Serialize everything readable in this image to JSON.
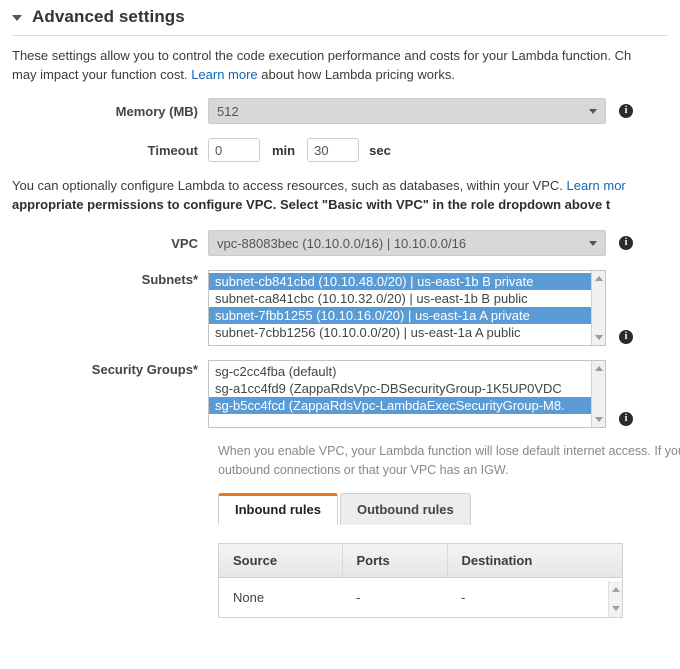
{
  "section": {
    "title": "Advanced settings",
    "collapse_icon": "caret-down-icon"
  },
  "intro": {
    "line1": "These settings allow you to control the code execution performance and costs for your Lambda function. Ch",
    "line2_before_link": "may impact your function cost. ",
    "link_text": "Learn more",
    "line2_after_link": " about how Lambda pricing works."
  },
  "memory": {
    "label": "Memory (MB)",
    "value": "512",
    "info_icon": "info-icon"
  },
  "timeout": {
    "label": "Timeout",
    "minutes": "0",
    "minutes_unit": "min",
    "seconds": "30",
    "seconds_unit": "sec"
  },
  "vpc_intro": {
    "line1_before_link": "You can optionally configure Lambda to access resources, such as databases, within your VPC. ",
    "link_text": "Learn mor",
    "line2": "appropriate permissions to configure VPC. Select \"Basic with VPC\" in the role dropdown above t"
  },
  "vpc": {
    "label": "VPC",
    "value": "vpc-88083bec (10.10.0.0/16) | 10.10.0.0/16",
    "info_icon": "info-icon"
  },
  "subnets": {
    "label": "Subnets*",
    "options": [
      {
        "text": "subnet-cb841cbd (10.10.48.0/20) | us-east-1b B private",
        "selected": true
      },
      {
        "text": "subnet-ca841cbc (10.10.32.0/20) | us-east-1b B public",
        "selected": false
      },
      {
        "text": "subnet-7fbb1255 (10.10.16.0/20) | us-east-1a A private",
        "selected": true
      },
      {
        "text": "subnet-7cbb1256 (10.10.0.0/20) | us-east-1a A public",
        "selected": false
      }
    ],
    "info_icon": "info-icon"
  },
  "security_groups": {
    "label": "Security Groups*",
    "options": [
      {
        "text": "sg-c2cc4fba (default)",
        "selected": false
      },
      {
        "text": "sg-a1cc4fd9 (ZappaRdsVpc-DBSecurityGroup-1K5UP0VDC",
        "selected": false
      },
      {
        "text": "sg-b5cc4fcd (ZappaRdsVpc-LambdaExecSecurityGroup-M8.",
        "selected": true
      }
    ],
    "info_icon": "info-icon"
  },
  "vpc_note": {
    "line1": "When you enable VPC, your Lambda function will lose default internet access. If you r",
    "line2": "outbound connections or that your VPC has an IGW."
  },
  "tabs": [
    {
      "label": "Inbound rules",
      "active": true
    },
    {
      "label": "Outbound rules",
      "active": false
    }
  ],
  "rules_table": {
    "columns": [
      "Source",
      "Ports",
      "Destination"
    ],
    "rows": [
      [
        "None",
        "-",
        "-"
      ]
    ]
  },
  "colors": {
    "accent_orange": "#e8761b",
    "selection_blue": "#5b9bd5",
    "link_blue": "#1166bb",
    "select_grey": "#d8d8d8"
  }
}
